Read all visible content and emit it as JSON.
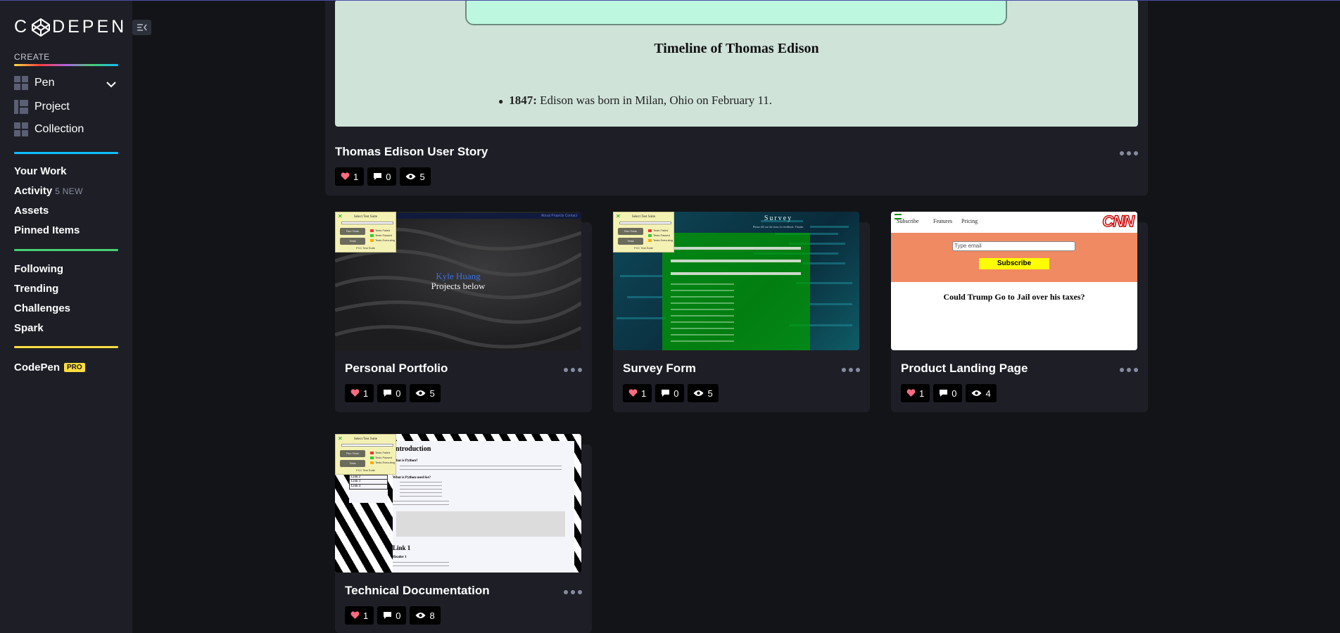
{
  "brand": {
    "name": "CODEPEN"
  },
  "sidebar": {
    "create_label": "CREATE",
    "create_items": [
      {
        "label": "Pen",
        "icon": "pen-grid-icon"
      },
      {
        "label": "Project",
        "icon": "project-grid-icon"
      },
      {
        "label": "Collection",
        "icon": "collection-grid-icon"
      }
    ],
    "nav_primary": [
      {
        "label": "Your Work"
      },
      {
        "label": "Activity",
        "sub": "5 NEW"
      },
      {
        "label": "Assets"
      },
      {
        "label": "Pinned Items"
      }
    ],
    "nav_secondary": [
      {
        "label": "Following"
      },
      {
        "label": "Trending"
      },
      {
        "label": "Challenges"
      },
      {
        "label": "Spark"
      }
    ],
    "codepen_pro": {
      "label": "CodePen",
      "badge": "PRO"
    }
  },
  "featured": {
    "title": "Thomas Edison User Story",
    "preview": {
      "heading": "Timeline of Thomas Edison",
      "item_year": "1847:",
      "item_text": "Edison was born in Milan, Ohio on February 11."
    },
    "stats": {
      "likes": "1",
      "comments": "0",
      "views": "5"
    }
  },
  "mini_panel": {
    "title": "Select Test Suite",
    "run_label": "Run Tests",
    "tests_label": "Tests",
    "legend": [
      "Tests Failed",
      "Tests Passed",
      "Tests Executing"
    ],
    "footer": "FCC Test Suite"
  },
  "cards": [
    {
      "title": "Personal Portfolio",
      "preview": {
        "name": "Kyle Huang",
        "tagline": "Projects below",
        "nav": "About Projects Contact"
      },
      "stats": {
        "likes": "1",
        "comments": "0",
        "views": "5"
      }
    },
    {
      "title": "Survey Form",
      "preview": {
        "heading": "Survey",
        "sub": "Please fill out the form for feedback. Thanks."
      },
      "stats": {
        "likes": "1",
        "comments": "0",
        "views": "5"
      }
    },
    {
      "title": "Product Landing Page",
      "preview": {
        "nav": [
          "Subscribe",
          "Features",
          "Pricing"
        ],
        "logo": "CNN",
        "email_placeholder": "Type email",
        "button": "Subscribe",
        "headline": "Could Trump Go to Jail over his taxes?"
      },
      "stats": {
        "likes": "1",
        "comments": "0",
        "views": "4"
      }
    },
    {
      "title": "Technical Documentation",
      "preview": {
        "heading": "Introduction",
        "sub1": "What is Python?",
        "sub2": "What is Python used for?",
        "links": [
          "Link 1",
          "Link 2",
          "Link 3",
          "Link 4"
        ],
        "section": "Link 1",
        "header": "Header 1"
      },
      "stats": {
        "likes": "1",
        "comments": "0",
        "views": "8"
      }
    }
  ],
  "colors": {
    "background": "#131417",
    "sidebar": "#1e1f26",
    "card": "#1e1f26",
    "heart": "#ff6b81",
    "pro_badge": "#ffdd40",
    "blue_line": "#0ebeff",
    "green_line": "#47cf73"
  }
}
